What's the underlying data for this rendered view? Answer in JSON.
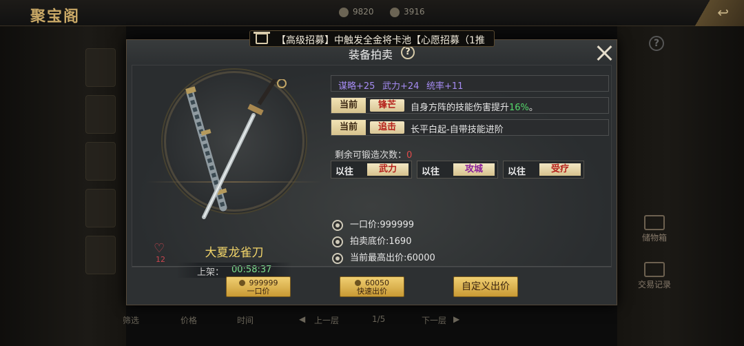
{
  "header": {
    "title": "聚宝阁",
    "currency_1": "9820",
    "currency_2": "3916"
  },
  "marquee": {
    "text": "【高级招募】中触发全金将卡池【心愿招募（1推"
  },
  "dialog": {
    "title": "装备拍卖",
    "help_symbol": "?",
    "close_symbol": "✕"
  },
  "item": {
    "name": "大夏龙雀刀",
    "likes": "12",
    "listing_label": "上架：",
    "listing_time": "00:58:37"
  },
  "stats": [
    {
      "label": "谋略+25"
    },
    {
      "label": "武力+24"
    },
    {
      "label": "统率+11"
    }
  ],
  "skills": [
    {
      "tag": "当前",
      "name": "锋芒",
      "desc": "自身方阵的技能伤害提升",
      "pct": "16%",
      "suffix": "。"
    },
    {
      "tag": "当前",
      "name": "追击",
      "desc": "长平白起-自带技能进阶",
      "pct": "",
      "suffix": ""
    }
  ],
  "forge": {
    "label": "剩余可锻造次数：",
    "count": "0",
    "options": [
      {
        "prev": "以往",
        "attr": "武力",
        "color": "#b4201a"
      },
      {
        "prev": "以往",
        "attr": "攻城",
        "color": "#8a1f9a"
      },
      {
        "prev": "以往",
        "attr": "受疗",
        "color": "#b4201a"
      }
    ]
  },
  "prices": {
    "buyout": "一口价:999999",
    "reserve": "拍卖底价:1690",
    "highest_bid": "当前最高出价:60000"
  },
  "buttons": {
    "buyout_price": "999999",
    "buyout_label": "一口价",
    "quick_price": "60050",
    "quick_label": "快速出价",
    "custom_label": "自定义出价"
  },
  "background": {
    "right_btn_1": "储物箱",
    "right_btn_2": "交易记录",
    "bottom_filter": "筛选",
    "bottom_price": "价格",
    "bottom_time": "时间",
    "bottom_prev": "上一层",
    "bottom_page": "1/5",
    "bottom_next": "下一层"
  },
  "colors": {
    "accent_gold": "#f2d56a",
    "timer_green": "#7ee08f",
    "stat_purple": "#a58bf2",
    "warn_red": "#e24b4b"
  }
}
